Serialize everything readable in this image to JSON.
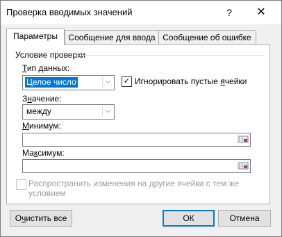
{
  "window": {
    "title": "Проверка вводимых значений",
    "help_label": "?",
    "close_label": "✕"
  },
  "tabs": [
    {
      "label": "Параметры",
      "active": true
    },
    {
      "label": "Сообщение для ввода",
      "active": false
    },
    {
      "label": "Сообщение об ошибке",
      "active": false
    }
  ],
  "panel": {
    "group_title": "Условие проверки",
    "data_type_label_u": "Т",
    "data_type_label_rest": "ип данных:",
    "data_type_value": "Целое число",
    "ignore_blank_label_prefix": "Игнорировать пустые ",
    "ignore_blank_label_u": "я",
    "ignore_blank_label_suffix": "чейки",
    "ignore_blank_checked": "✓",
    "value_label_prefix": "З",
    "value_label_u": "н",
    "value_label_rest": "ачение:",
    "value_value": "между",
    "min_label_u": "М",
    "min_label_rest": "инимум:",
    "min_value": "",
    "max_label_prefix": "Ма",
    "max_label_u": "к",
    "max_label_rest": "симум:",
    "max_value": "",
    "apply_label": "Распространить изменения на другие ячейки с тем же условием"
  },
  "buttons": {
    "clear_prefix": "О",
    "clear_u": "ч",
    "clear_rest": "истить все",
    "ok": "ОК",
    "cancel": "Отмена"
  },
  "colors": {
    "accent": "#0078d7",
    "dialog_bg": "#f0f0f0"
  }
}
